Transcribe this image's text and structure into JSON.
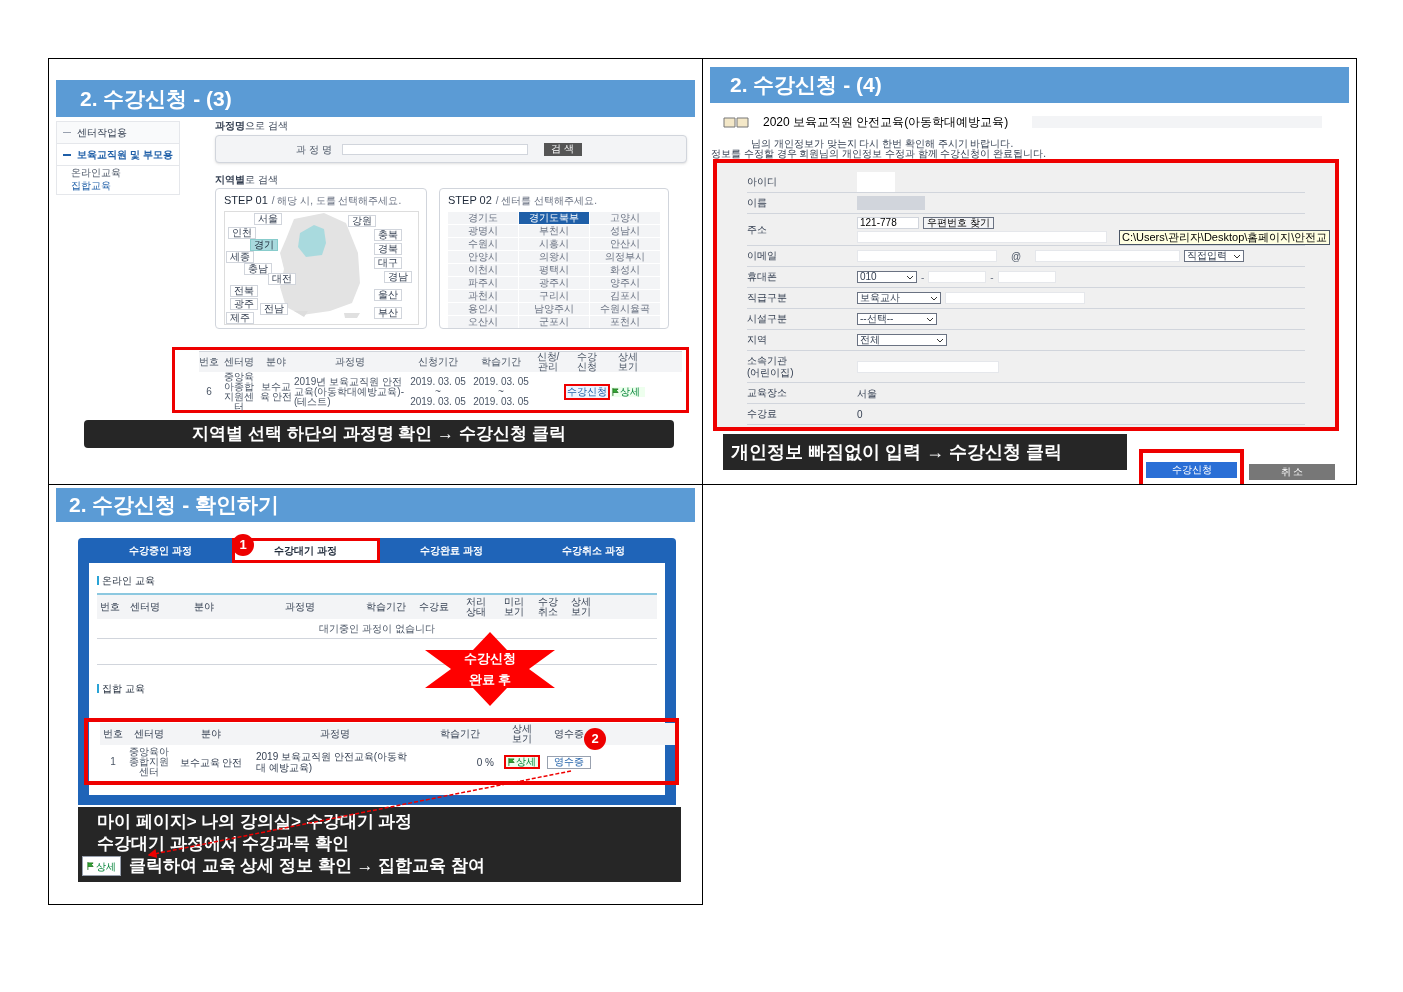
{
  "panel_3": {
    "title": "2. 수강신청 - (3)",
    "sidebar": {
      "items": [
        {
          "label": "센터작업용",
          "selected": false
        },
        {
          "label": "보육교직원 및 부모용",
          "selected": true
        }
      ],
      "subitems": [
        {
          "label": "온라인교육",
          "selected": false
        },
        {
          "label": "집합교육",
          "selected": true
        }
      ]
    },
    "course_search": {
      "heading": "**과정명**으로 검색",
      "label": "과 정 명",
      "button": "검 색"
    },
    "region_search": {
      "heading": "**지역별**로 검색",
      "step1": {
        "title": "STEP 01",
        "hint": "/ 해당 시, 도를 선택해주세요.",
        "regions": [
          {
            "label": "서울",
            "selected": false
          },
          {
            "label": "강원",
            "selected": false
          },
          {
            "label": "인천",
            "selected": false
          },
          {
            "label": "충북",
            "selected": false
          },
          {
            "label": "경기",
            "selected": true
          },
          {
            "label": "경북",
            "selected": false
          },
          {
            "label": "세종",
            "selected": false
          },
          {
            "label": "대구",
            "selected": false
          },
          {
            "label": "충남",
            "selected": false
          },
          {
            "label": "경남",
            "selected": false
          },
          {
            "label": "대전",
            "selected": false
          },
          {
            "label": "울산",
            "selected": false
          },
          {
            "label": "전북",
            "selected": false
          },
          {
            "label": "부산",
            "selected": false
          },
          {
            "label": "광주",
            "selected": false
          },
          {
            "label": "전남",
            "selected": false
          },
          {
            "label": "제주",
            "selected": false
          }
        ]
      },
      "step2": {
        "title": "STEP 02",
        "hint": "/ 센터를 선택해주세요.",
        "centers": [
          {
            "label": "경기도",
            "selected": false
          },
          {
            "label": "경기도북부",
            "selected": true
          },
          {
            "label": "고양시",
            "selected": false
          },
          {
            "label": "광명시",
            "selected": false
          },
          {
            "label": "부천시",
            "selected": false
          },
          {
            "label": "성남시",
            "selected": false
          },
          {
            "label": "수원시",
            "selected": false
          },
          {
            "label": "시흥시",
            "selected": false
          },
          {
            "label": "안산시",
            "selected": false
          },
          {
            "label": "안양시",
            "selected": false
          },
          {
            "label": "의왕시",
            "selected": false
          },
          {
            "label": "의정부시",
            "selected": false
          },
          {
            "label": "이천시",
            "selected": false
          },
          {
            "label": "평택시",
            "selected": false
          },
          {
            "label": "화성시",
            "selected": false
          },
          {
            "label": "파주시",
            "selected": false
          },
          {
            "label": "광주시",
            "selected": false
          },
          {
            "label": "양주시",
            "selected": false
          },
          {
            "label": "과천시",
            "selected": false
          },
          {
            "label": "구리시",
            "selected": false
          },
          {
            "label": "김포시",
            "selected": false
          },
          {
            "label": "용인시",
            "selected": false
          },
          {
            "label": "남양주시",
            "selected": false
          },
          {
            "label": "수원시율곡",
            "selected": false
          },
          {
            "label": "오산시",
            "selected": false
          },
          {
            "label": "군포시",
            "selected": false
          },
          {
            "label": "포천시",
            "selected": false
          }
        ]
      }
    },
    "table": {
      "columns": [
        "번호",
        "센터명",
        "분야",
        "과정명",
        "신청기간",
        "학습기간",
        "신청/\n관리",
        "수강\n신청",
        "상세\n보기"
      ],
      "rows": [
        {
          "cells": [
            "6",
            "중앙육아종합지원센터",
            "보수교육 안전",
            "2019년 보육교직원 안전교육(아동학대예방교육)- (테스트)",
            "2019. 03. 05\n~\n2019. 03. 05",
            "2019. 03. 05\n~\n2019. 03. 05"
          ],
          "apply_button": "수강신청",
          "detail_button": "상세"
        }
      ]
    },
    "caption": "지역별 선택 하단의 과정명 확인 → 수강신청 클릭"
  },
  "panel_4": {
    "title": "2. 수강신청 - (4)",
    "course_title": "2020 보육교직원 안전교육(아동학대예방교육)",
    "notices": [
      "님의 개인정보가 맞는지 다시 한번 확인해 주시기 바랍니다.",
      "정보를 수정할 경우 회원님의 개인정보 수정과 함께 수강신청이 완료됩니다."
    ],
    "form": [
      {
        "kind": "blank",
        "label": "아이디"
      },
      {
        "kind": "readonly",
        "label": "이름"
      },
      {
        "kind": "address",
        "label": "주소",
        "value": "121-778",
        "button": "우편번호 찾기"
      },
      {
        "kind": "email",
        "label": "이메일",
        "separator": "@",
        "select": "직접입력"
      },
      {
        "kind": "phone",
        "label": "휴대폰",
        "select": "010",
        "separator": "-"
      },
      {
        "kind": "select_input",
        "label": "직급구분",
        "select": "보육교사"
      },
      {
        "kind": "select",
        "label": "시설구분",
        "select": "--선택--"
      },
      {
        "kind": "select",
        "label": "지역",
        "select": "전체"
      },
      {
        "kind": "input",
        "label": "소속기관\n(어린이집)"
      },
      {
        "kind": "text",
        "label": "교육장소",
        "value": "서울"
      },
      {
        "kind": "text",
        "label": "수강료",
        "value": "0"
      }
    ],
    "tooltip": "C:\\Users\\관리자\\Desktop\\홈페이지\\안전교",
    "caption": "개인정보 빠짐없이 입력 → 수강신청 클릭",
    "buttons": [
      {
        "kind": "primary",
        "label": "수강신청"
      },
      {
        "kind": "secondary",
        "label": "취 소"
      }
    ]
  },
  "panel_confirm": {
    "title": "2. 수강신청 - 확인하기",
    "tabs": [
      {
        "label": "수강중인 과정",
        "selected": false
      },
      {
        "label": "수강대기 과정",
        "selected": true
      },
      {
        "label": "수강완료 과정",
        "selected": false
      },
      {
        "label": "수강취소 과정",
        "selected": false
      }
    ],
    "online": {
      "heading": "온라인 교육",
      "columns": [
        "번호",
        "센터명",
        "분야",
        "과정명",
        "학습기간",
        "수강료",
        "처리\n상태",
        "미리\n보기",
        "수강\n취소",
        "상세\n보기"
      ],
      "empty": "대기중인 과정이 없습니다"
    },
    "burst": "수강신청\n완료 후",
    "group": {
      "heading": "집합 교육",
      "columns": [
        "번호",
        "센터명",
        "분야",
        "과정명",
        "학습기간",
        "상세\n보기",
        "영수증"
      ],
      "rows": [
        {
          "cells": [
            "1",
            "중앙육아\n종합지원\n센터",
            "보수교육 안전",
            "2019 보육교직원 안전교육(아동학\n대 예방교육)",
            "0 %"
          ],
          "detail_button": "상세",
          "receipt_button": "영수증"
        }
      ]
    },
    "markers": [
      "1",
      "2"
    ],
    "caption": {
      "lines": [
        "마이 페이지> 나의 강의실> **수강대기 과정**",
        "수강대기 과정에서 수강과목 확인"
      ],
      "detail_button": "상세",
      "last_line": "클릭하여 교육 상세 정보 확인 → 집합교육 참여"
    }
  }
}
